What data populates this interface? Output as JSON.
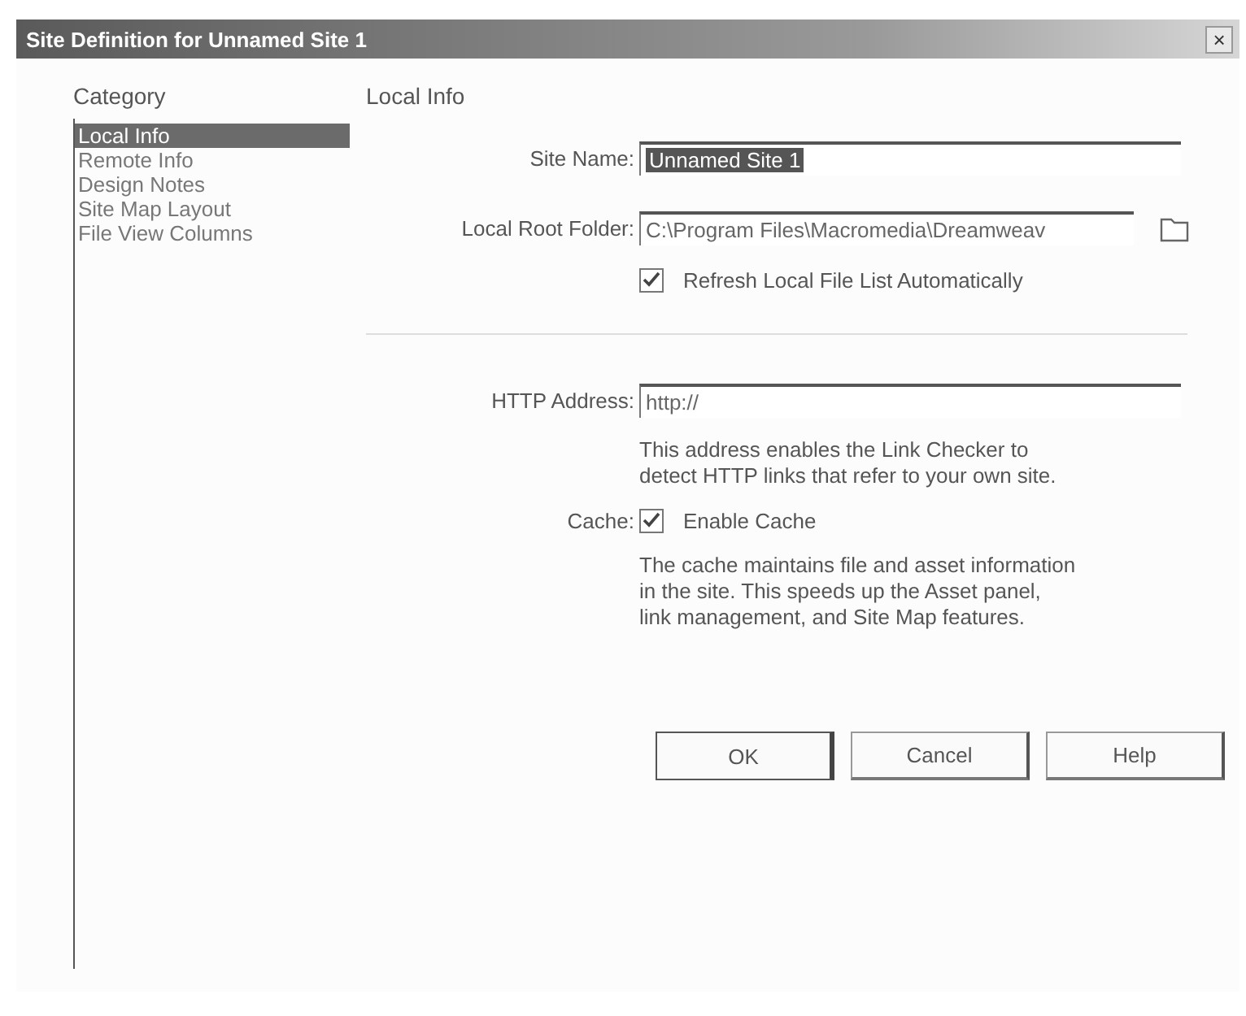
{
  "window": {
    "title": "Site Definition for Unnamed Site 1",
    "close": "×"
  },
  "sidebar": {
    "heading": "Category",
    "items": [
      {
        "label": "Local Info",
        "selected": true
      },
      {
        "label": "Remote Info",
        "selected": false
      },
      {
        "label": "Design Notes",
        "selected": false
      },
      {
        "label": "Site Map Layout",
        "selected": false
      },
      {
        "label": "File View Columns",
        "selected": false
      }
    ]
  },
  "panel": {
    "heading": "Local Info",
    "site_name": {
      "label": "Site Name:",
      "value": "Unnamed Site 1"
    },
    "local_root_folder": {
      "label": "Local Root Folder:",
      "value": "C:\\Program Files\\Macromedia\\Dreamweav"
    },
    "refresh": {
      "label": "Refresh Local File List Automatically",
      "checked": true
    },
    "http_address": {
      "label": "HTTP Address:",
      "value": "http://",
      "note": "This address enables the Link Checker to detect HTTP links that refer to your own site."
    },
    "cache": {
      "label": "Cache:",
      "option": "Enable Cache",
      "checked": true,
      "note": "The cache maintains file and asset information in the site.  This speeds up the Asset panel, link management, and Site Map features."
    }
  },
  "buttons": [
    "OK",
    "Cancel",
    "Help"
  ]
}
